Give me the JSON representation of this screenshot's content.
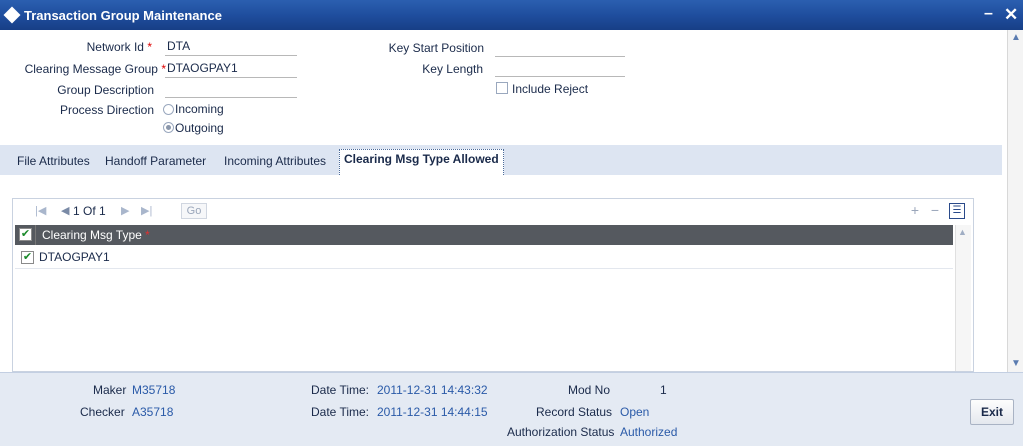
{
  "window": {
    "title": "Transaction Group Maintenance",
    "minimize": "–",
    "close": "✕"
  },
  "form": {
    "network_id_label": "Network Id",
    "network_id_value": "DTA",
    "clearing_group_label": "Clearing Message Group",
    "clearing_group_value": "DTAOGPAY1",
    "group_desc_label": "Group Description",
    "group_desc_value": "",
    "process_direction_label": "Process Direction",
    "direction_incoming": "Incoming",
    "direction_outgoing": "Outgoing",
    "direction_selected": "Outgoing",
    "key_start_label": "Key Start Position",
    "key_start_value": "",
    "key_length_label": "Key Length",
    "key_length_value": "",
    "include_reject_label": "Include Reject",
    "include_reject_checked": false,
    "required_mark": "*"
  },
  "tabs": [
    {
      "label": "File Attributes"
    },
    {
      "label": "Handoff Parameter"
    },
    {
      "label": "Incoming Attributes"
    },
    {
      "label": "Clearing Msg Type Allowed",
      "active": true
    }
  ],
  "grid": {
    "pager_text": "1 Of 1",
    "go_label": "Go",
    "column_header": "Clearing Msg Type",
    "rows": [
      {
        "value": "DTAOGPAY1",
        "checked": true
      }
    ]
  },
  "footer": {
    "maker_label": "Maker",
    "maker_value": "M35718",
    "checker_label": "Checker",
    "checker_value": "A35718",
    "datetime_label": "Date Time:",
    "maker_datetime": "2011-12-31 14:43:32",
    "checker_datetime": "2011-12-31 14:44:15",
    "mod_no_label": "Mod No",
    "mod_no_value": "1",
    "record_status_label": "Record Status",
    "record_status_value": "Open",
    "auth_status_label": "Authorization Status",
    "auth_status_value": "Authorized",
    "exit_label": "Exit"
  },
  "colors": {
    "title_bar": "#1f4e9e",
    "tab_bar": "#dde5f2",
    "grid_header": "#55595f",
    "footer": "#e4eaf3",
    "value_link": "#2a5aa8"
  }
}
